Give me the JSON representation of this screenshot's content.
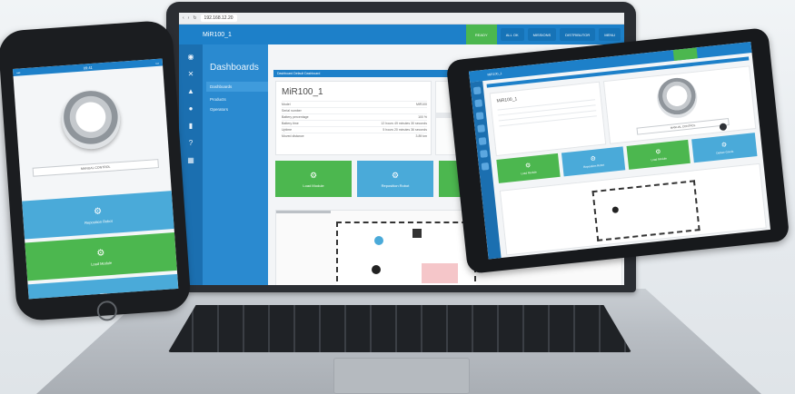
{
  "laptop": {
    "browser": {
      "url": "192.168.12.20"
    },
    "header": {
      "robot_name": "MiR100_1",
      "status_label": "READY",
      "pills": [
        "ALL OK",
        "MISSIONS",
        "DISTRIBUTOR",
        "MENU"
      ]
    },
    "sidebar_icons": [
      "robot-icon",
      "tools-icon",
      "factory-icon",
      "map-icon",
      "chart-icon",
      "help-icon",
      "grid-icon"
    ],
    "subnav": {
      "title": "Dashboards",
      "items": [
        "Dashboards",
        "Products",
        "Operators"
      ]
    },
    "breadcrumb": {
      "left": "Dashboard Default Dashboard",
      "right": "Manage"
    },
    "robot_card": {
      "title": "MiR100_1",
      "rows": [
        {
          "label": "Model",
          "value": "MiR100"
        },
        {
          "label": "Serial number",
          "value": ""
        },
        {
          "label": "Battery percentage",
          "value": "100 %"
        },
        {
          "label": "Battery time",
          "value": "12 hours 49 minutes 30 seconds"
        },
        {
          "label": "Uptime",
          "value": "5 hours 20 minutes 36 seconds"
        },
        {
          "label": "Moved distance",
          "value": "3.89 km"
        }
      ]
    },
    "tiles": [
      {
        "label": "Load Module",
        "icon": "gear-icon",
        "color": "#4cb74f"
      },
      {
        "label": "Reposition Robot",
        "icon": "gear-icon",
        "color": "#4aaad9"
      },
      {
        "label": "Deliver Goods",
        "icon": "gear-icon",
        "color": "#4cb74f"
      }
    ]
  },
  "phone": {
    "time": "09:41",
    "manual_control": "MANUAL CONTROL",
    "tiles": [
      {
        "label": "Reposition Robot",
        "icon": "gear-icon",
        "color": "#4aaad9"
      },
      {
        "label": "Load Module",
        "icon": "gear-icon",
        "color": "#4cb74f"
      },
      {
        "label": "",
        "icon": "grid-icon",
        "color": "#4aaad9"
      }
    ]
  },
  "tablet": {
    "robot_name": "MiR100_1",
    "manual_control": "MANUAL CONTROL",
    "tiles": [
      {
        "label": "Load Module",
        "icon": "gear-icon",
        "color": "#4cb74f"
      },
      {
        "label": "Reposition Robot",
        "icon": "gear-icon",
        "color": "#4aaad9"
      },
      {
        "label": "Load Module",
        "icon": "gear-icon",
        "color": "#4cb74f"
      },
      {
        "label": "Deliver Goods",
        "icon": "gear-icon",
        "color": "#4aaad9"
      }
    ]
  }
}
